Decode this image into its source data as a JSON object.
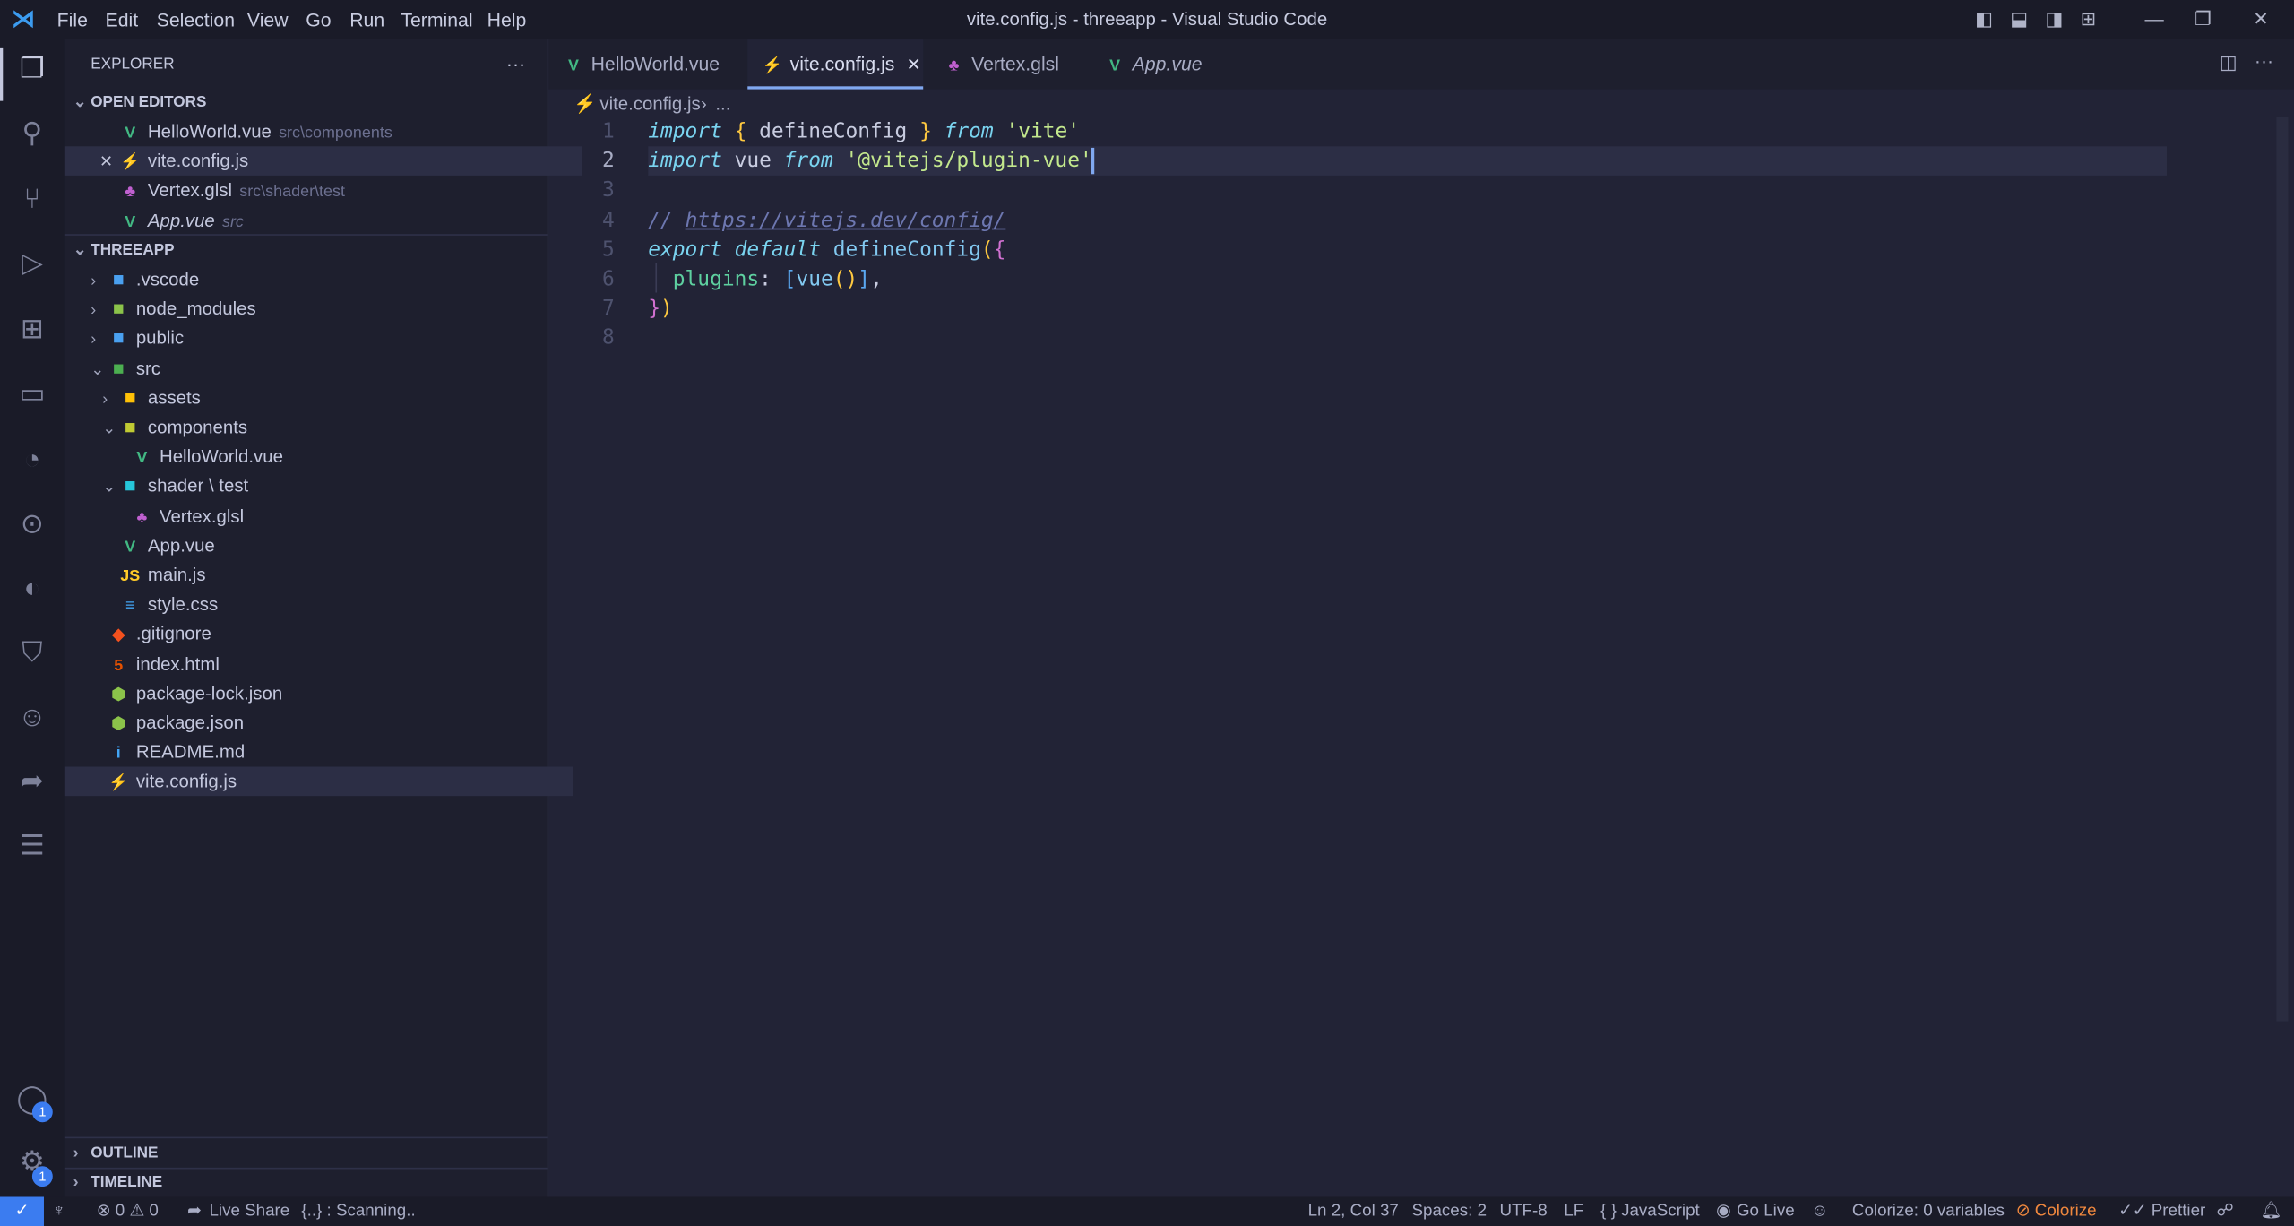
{
  "window": {
    "title": "vite.config.js - threeapp - Visual Studio Code",
    "menu": [
      "File",
      "Edit",
      "Selection",
      "View",
      "Go",
      "Run",
      "Terminal",
      "Help"
    ]
  },
  "activity_bar": {
    "icons": [
      "files-icon",
      "search-icon",
      "source-control-icon",
      "run-debug-icon",
      "extensions-icon",
      "remote-explorer-icon",
      "git-history-icon",
      "git-graph-icon",
      "edge-icon",
      "bookmark-icon",
      "copilot-icon",
      "live-share-icon",
      "list-icon"
    ],
    "account_badge": "1",
    "settings_badge": "1"
  },
  "sidebar": {
    "title": "EXPLORER",
    "more": "···",
    "open_editors": {
      "label": "OPEN EDITORS",
      "items": [
        {
          "name": "HelloWorld.vue",
          "desc": "src\\components",
          "icon": "V",
          "color": "#42b883"
        },
        {
          "name": "vite.config.js",
          "desc": "",
          "icon": "⚡",
          "color": "#ffc940",
          "close": "✕"
        },
        {
          "name": "Vertex.glsl",
          "desc": "src\\shader\\test",
          "icon": "♣",
          "color": "#c060d0"
        },
        {
          "name": "App.vue",
          "desc": "src",
          "icon": "V",
          "color": "#42b883"
        }
      ]
    },
    "project": {
      "label": "THREEAPP",
      "items": [
        {
          "name": ".vscode",
          "chev": "›",
          "icon": "■",
          "color": "#4aa0f0",
          "indent": 0
        },
        {
          "name": "node_modules",
          "chev": "›",
          "icon": "■",
          "color": "#8bc34a",
          "indent": 0
        },
        {
          "name": "public",
          "chev": "›",
          "icon": "■",
          "color": "#4aa0f0",
          "indent": 0
        },
        {
          "name": "src",
          "chev": "⌄",
          "icon": "■",
          "color": "#4caf50",
          "indent": 0
        },
        {
          "name": "assets",
          "chev": "›",
          "icon": "■",
          "color": "#ffc107",
          "indent": 1
        },
        {
          "name": "components",
          "chev": "⌄",
          "icon": "■",
          "color": "#c0ca33",
          "indent": 1
        },
        {
          "name": "HelloWorld.vue",
          "chev": "",
          "icon": "V",
          "color": "#42b883",
          "indent": 2
        },
        {
          "name": "shader \\ test",
          "chev": "⌄",
          "icon": "■",
          "color": "#26c6da",
          "indent": 1
        },
        {
          "name": "Vertex.glsl",
          "chev": "",
          "icon": "♣",
          "color": "#c060d0",
          "indent": 2
        },
        {
          "name": "App.vue",
          "chev": "",
          "icon": "V",
          "color": "#42b883",
          "indent": 1
        },
        {
          "name": "main.js",
          "chev": "",
          "icon": "JS",
          "color": "#ffca28",
          "indent": 1
        },
        {
          "name": "style.css",
          "chev": "",
          "icon": "≡",
          "color": "#42a5f5",
          "indent": 1
        },
        {
          "name": ".gitignore",
          "chev": "",
          "icon": "◆",
          "color": "#f4511e",
          "indent": 0
        },
        {
          "name": "index.html",
          "chev": "",
          "icon": "5",
          "color": "#e65100",
          "indent": 0
        },
        {
          "name": "package-lock.json",
          "chev": "",
          "icon": "⬢",
          "color": "#8bc34a",
          "indent": 0
        },
        {
          "name": "package.json",
          "chev": "",
          "icon": "⬢",
          "color": "#8bc34a",
          "indent": 0
        },
        {
          "name": "README.md",
          "chev": "",
          "icon": "i",
          "color": "#42a5f5",
          "indent": 0
        },
        {
          "name": "vite.config.js",
          "chev": "",
          "icon": "⚡",
          "color": "#ffc940",
          "indent": 0,
          "selected": true
        }
      ]
    },
    "outline": "OUTLINE",
    "timeline": "TIMELINE"
  },
  "tabs": [
    {
      "label": "HelloWorld.vue",
      "icon": "V",
      "color": "#42b883"
    },
    {
      "label": "vite.config.js",
      "icon": "⚡",
      "color": "#ffc940",
      "active": true,
      "close": "✕"
    },
    {
      "label": "Vertex.glsl",
      "icon": "♣",
      "color": "#c060d0"
    },
    {
      "label": "App.vue",
      "icon": "V",
      "color": "#42b883",
      "italic": true
    }
  ],
  "breadcrumb": {
    "file": "vite.config.js",
    "sep": "›",
    "rest": "..."
  },
  "editor": {
    "current_line": 2,
    "line_numbers": [
      "1",
      "2",
      "3",
      "4",
      "5",
      "6",
      "7",
      "8"
    ],
    "tokens": {
      "l1": [
        "import",
        " ",
        "{",
        " defineConfig ",
        "}",
        " ",
        "from",
        " ",
        "'vite'"
      ],
      "l2": [
        "import",
        " vue ",
        "from",
        " ",
        "'@vitejs/plugin-vue'"
      ],
      "l4": [
        "// ",
        "https://vitejs.dev/config/"
      ],
      "l5": [
        "export",
        " ",
        "default",
        " ",
        "defineConfig",
        "(",
        "{"
      ],
      "l6": [
        "  ",
        "plugins",
        ": ",
        "[",
        "vue",
        "(",
        ")",
        "]",
        ","
      ],
      "l7": [
        "}",
        ")"
      ]
    }
  },
  "status": {
    "left": [
      "⊗ 0 ⚠ 0",
      "Live Share",
      "{..} : Scanning.."
    ],
    "right": [
      "Ln 2, Col 37",
      "Spaces: 2",
      "UTF-8",
      "LF",
      "{ } JavaScript",
      "Go Live",
      "Colorize: 0 variables",
      "Colorize",
      "✓✓ Prettier"
    ],
    "colorize_color": "#f0883e"
  }
}
